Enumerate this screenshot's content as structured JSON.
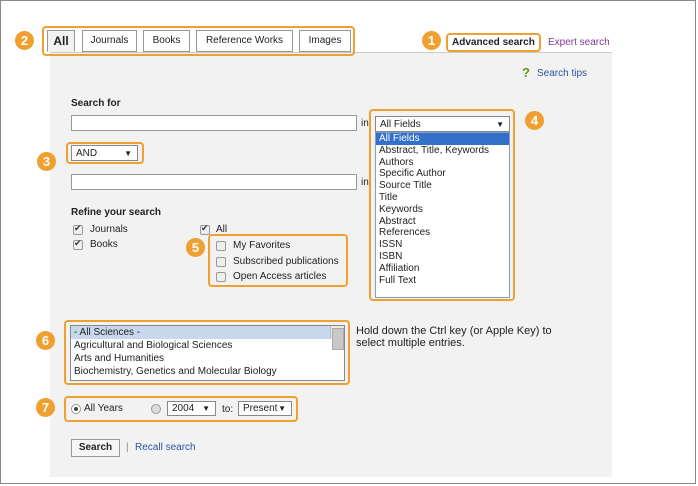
{
  "tabs": [
    {
      "label": "All",
      "active": true
    },
    {
      "label": "Journals"
    },
    {
      "label": "Books"
    },
    {
      "label": "Reference Works"
    },
    {
      "label": "Images"
    }
  ],
  "header_links": {
    "advanced": "Advanced search",
    "expert": "Expert search"
  },
  "callouts": [
    "1",
    "2",
    "3",
    "4",
    "5",
    "6",
    "7"
  ],
  "search_tips": "Search tips",
  "search_for_label": "Search for",
  "in_label": "in",
  "field_select": {
    "value": "All Fields"
  },
  "operator_select": {
    "value": "AND"
  },
  "field_options": [
    "All Fields",
    "Abstract, Title, Keywords",
    "Authors",
    "Specific Author",
    "Source Title",
    "Title",
    "Keywords",
    "Abstract",
    "References",
    "ISSN",
    "ISBN",
    "Affiliation",
    "Full Text"
  ],
  "refine": {
    "title": "Refine your search",
    "journals": "Journals",
    "books": "Books",
    "all": "All",
    "my_favorites": "My Favorites",
    "subscribed": "Subscribed publications",
    "open_access": "Open Access articles"
  },
  "subjects": [
    "- All Sciences -",
    "Agricultural and Biological Sciences",
    "Arts and Humanities",
    "Biochemistry, Genetics and Molecular Biology"
  ],
  "hint": "Hold down the Ctrl key (or Apple Key) to select multiple entries.",
  "years": {
    "all_years": "All Years",
    "from": "2004",
    "to_label": "to:",
    "to": "Present"
  },
  "buttons": {
    "search": "Search",
    "separator": "|",
    "recall": "Recall search"
  },
  "colors": {
    "callout": "#f0a030",
    "link": "#2a55a0",
    "selected": "#3470c8"
  }
}
